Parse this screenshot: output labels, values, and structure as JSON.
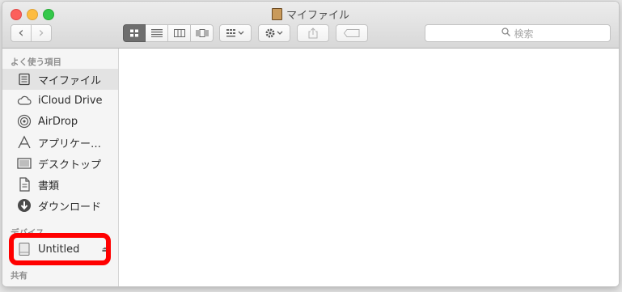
{
  "window": {
    "title": "マイファイル"
  },
  "toolbar": {
    "back_icon": "‹",
    "forward_icon": "›",
    "views": [
      {
        "name": "icon-view",
        "active": true
      },
      {
        "name": "list-view",
        "active": false
      },
      {
        "name": "column-view",
        "active": false
      },
      {
        "name": "cover-flow-view",
        "active": false
      }
    ],
    "search_placeholder": "検索"
  },
  "sidebar": {
    "favorites_title": "よく使う項目",
    "favorites": [
      {
        "label": "マイファイル",
        "icon": "all-my-files-icon",
        "selected": true
      },
      {
        "label": "iCloud Drive",
        "icon": "cloud-icon",
        "selected": false
      },
      {
        "label": "AirDrop",
        "icon": "airdrop-icon",
        "selected": false
      },
      {
        "label": "アプリケー…",
        "icon": "applications-icon",
        "selected": false
      },
      {
        "label": "デスクトップ",
        "icon": "desktop-icon",
        "selected": false
      },
      {
        "label": "書類",
        "icon": "documents-icon",
        "selected": false
      },
      {
        "label": "ダウンロード",
        "icon": "downloads-icon",
        "selected": false
      }
    ],
    "devices_title": "デバイス",
    "devices": [
      {
        "label": "Untitled",
        "icon": "disk-icon",
        "eject": "⏏"
      }
    ],
    "shared_title": "共有"
  },
  "colors": {
    "annotation": "#ff0000"
  }
}
